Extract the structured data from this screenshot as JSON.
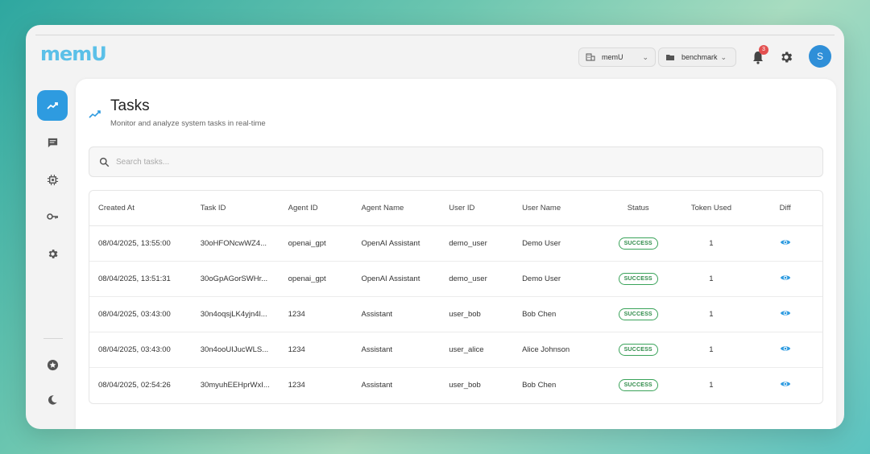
{
  "app": {
    "logo_text": "memU"
  },
  "header": {
    "org_selector": {
      "label": "memU",
      "icon": "building-icon"
    },
    "project_selector": {
      "label": "benchmark",
      "icon": "folder-icon"
    },
    "notifications": {
      "count": "3"
    },
    "avatar_initial": "S"
  },
  "sidebar": {
    "items": [
      {
        "name": "analytics",
        "icon": "trending-up-icon",
        "active": true
      },
      {
        "name": "messages",
        "icon": "chat-icon",
        "active": false
      },
      {
        "name": "agents",
        "icon": "chip-icon",
        "active": false
      },
      {
        "name": "api-keys",
        "icon": "key-icon",
        "active": false
      },
      {
        "name": "settings",
        "icon": "gear-icon",
        "active": false
      }
    ],
    "bottom": [
      {
        "name": "favorites",
        "icon": "star-icon"
      },
      {
        "name": "theme",
        "icon": "moon-icon"
      }
    ]
  },
  "page": {
    "title": "Tasks",
    "subtitle": "Monitor and analyze system tasks in real-time"
  },
  "search": {
    "placeholder": "Search tasks..."
  },
  "table": {
    "headers": [
      "Created At",
      "Task ID",
      "Agent ID",
      "Agent Name",
      "User ID",
      "User Name",
      "Status",
      "Token Used",
      "Diff"
    ],
    "rows": [
      {
        "created_at": "08/04/2025, 13:55:00",
        "task_id": "30oHFONcwWZ4...",
        "agent_id": "openai_gpt",
        "agent_name": "OpenAI Assistant",
        "user_id": "demo_user",
        "user_name": "Demo User",
        "status": "SUCCESS",
        "tokens": "1"
      },
      {
        "created_at": "08/04/2025, 13:51:31",
        "task_id": "30oGpAGorSWHr...",
        "agent_id": "openai_gpt",
        "agent_name": "OpenAI Assistant",
        "user_id": "demo_user",
        "user_name": "Demo User",
        "status": "SUCCESS",
        "tokens": "1"
      },
      {
        "created_at": "08/04/2025, 03:43:00",
        "task_id": "30n4oqsjLK4yjn4l...",
        "agent_id": "1234",
        "agent_name": "Assistant",
        "user_id": "user_bob",
        "user_name": "Bob Chen",
        "status": "SUCCESS",
        "tokens": "1"
      },
      {
        "created_at": "08/04/2025, 03:43:00",
        "task_id": "30n4ooUIJucWLS...",
        "agent_id": "1234",
        "agent_name": "Assistant",
        "user_id": "user_alice",
        "user_name": "Alice Johnson",
        "status": "SUCCESS",
        "tokens": "1"
      },
      {
        "created_at": "08/04/2025, 02:54:26",
        "task_id": "30myuhEEHprWxI...",
        "agent_id": "1234",
        "agent_name": "Assistant",
        "user_id": "user_bob",
        "user_name": "Bob Chen",
        "status": "SUCCESS",
        "tokens": "1"
      }
    ]
  },
  "colors": {
    "accent": "#2e9be0",
    "success": "#3aa35a",
    "badge": "#e35050"
  }
}
